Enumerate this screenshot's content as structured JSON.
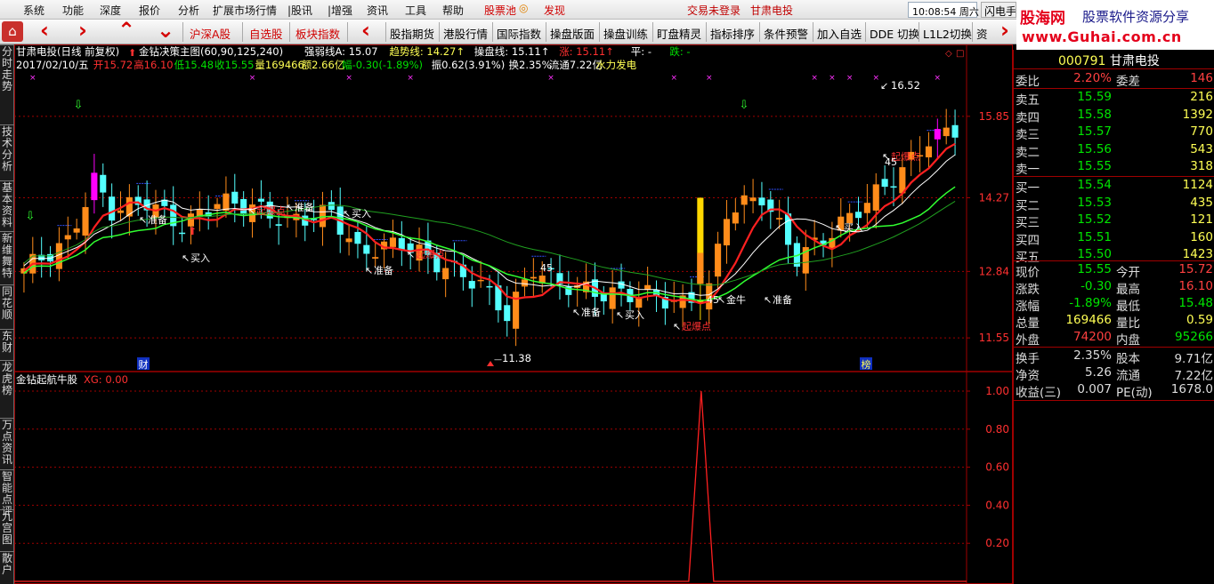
{
  "menu": [
    "系统",
    "功能",
    "深度",
    "报价",
    "分析",
    "扩展市场行情",
    "|股讯",
    "|增强",
    "资讯",
    "工具",
    "帮助"
  ],
  "menu_red": [
    "股票池",
    "发现"
  ],
  "login_text": "交易未登录",
  "broker_text": "甘肃电投",
  "clock": "10:08:54 周六",
  "flash": "闪电手",
  "logo": {
    "brand": "股海网",
    "slogan": "股票软件资源分享",
    "url": "www.Guhai.com.cn"
  },
  "toolbar": {
    "red": [
      "沪深A股",
      "自选股",
      "板块指数"
    ],
    "black": [
      "股指期货",
      "港股行情",
      "国际指数",
      "操盘版面",
      "操盘训练",
      "盯盘精灵",
      "指标排序",
      "条件预警",
      "加入自选",
      "DDE 切换",
      "L1L2切换",
      "资"
    ]
  },
  "left_tabs": [
    "分时走势",
    "技术分析",
    "基本资料",
    "新维舞特",
    "同花顺",
    "东财",
    "龙虎榜",
    "万点资讯",
    "智能点评",
    "九宫图",
    "散户"
  ],
  "header": {
    "line1_name": "甘肃电投(日线 前复权)",
    "line1_indicator": "金钻决策主图(60,90,125,240)",
    "line1_parts": [
      {
        "t": "强弱线A: 15.07",
        "c": "#ffffff"
      },
      {
        "t": "趋势线: 14.27↑",
        "c": "#ffff54"
      },
      {
        "t": "操盘线: 15.11↑",
        "c": "#ffffff"
      },
      {
        "t": "涨: 15.11↑",
        "c": "#ff3030"
      },
      {
        "t": "平: -",
        "c": "#ffffff"
      },
      {
        "t": "跌: -",
        "c": "#00e000"
      }
    ],
    "line2_parts": [
      {
        "t": "2017/02/10/五",
        "c": "#ffffff"
      },
      {
        "t": "开15.72",
        "c": "#ff3030"
      },
      {
        "t": "高16.10",
        "c": "#ff3030"
      },
      {
        "t": "低15.48",
        "c": "#00e000"
      },
      {
        "t": "收15.55",
        "c": "#00e000"
      },
      {
        "t": "量169466",
        "c": "#ffff54"
      },
      {
        "t": "额2.66亿",
        "c": "#ffff54"
      },
      {
        "t": "幅-0.30(-1.89%)",
        "c": "#00e000"
      },
      {
        "t": "振0.62(3.91%)",
        "c": "#ffffff"
      },
      {
        "t": "换2.35%",
        "c": "#ffffff"
      },
      {
        "t": "流通7.22亿",
        "c": "#ffffff"
      },
      {
        "t": "水力发电",
        "c": "#ffff54"
      }
    ]
  },
  "main_axis": {
    "ticks": [
      "15.85",
      "14.27",
      "12.84",
      "11.55"
    ]
  },
  "sub": {
    "title": "金钻起航牛股",
    "value_label": "XG: 0.00",
    "ticks": [
      "1.00",
      "0.80",
      "0.60",
      "0.40",
      "0.20"
    ]
  },
  "marks": {
    "high": "16.52",
    "low": "11.38",
    "mid1": "45",
    "mid2": "45",
    "mid3": "45"
  },
  "signals": {
    "zhunbei": "准备",
    "mairu": "买入",
    "qibaodian": "起爆点",
    "jinniu": "金牛",
    "cai": "财",
    "bang": "榜"
  },
  "colors": {
    "up": "#ff8c1a",
    "down": "#54ffff",
    "red_line": "#ff2020",
    "green_line": "#20d020",
    "white_line": "#ffffff",
    "magenta": "#ff00ff",
    "grid": "#a00000"
  },
  "chart_data": {
    "type": "candlestick",
    "count": 107,
    "ylim": [
      11.0,
      16.9
    ],
    "close_last": 15.55,
    "bigbar_index": 77,
    "signal_value": 1.0
  },
  "quote": {
    "code": "000791",
    "name": "甘肃电投",
    "weibi": {
      "label": "委比",
      "value": "2.20%",
      "label2": "委差",
      "value2": "146"
    },
    "asks": [
      {
        "l": "卖五",
        "p": "15.59",
        "v": "216"
      },
      {
        "l": "卖四",
        "p": "15.58",
        "v": "1392"
      },
      {
        "l": "卖三",
        "p": "15.57",
        "v": "770"
      },
      {
        "l": "卖二",
        "p": "15.56",
        "v": "543"
      },
      {
        "l": "卖一",
        "p": "15.55",
        "v": "318"
      }
    ],
    "bids": [
      {
        "l": "买一",
        "p": "15.54",
        "v": "1124"
      },
      {
        "l": "买二",
        "p": "15.53",
        "v": "435"
      },
      {
        "l": "买三",
        "p": "15.52",
        "v": "121"
      },
      {
        "l": "买四",
        "p": "15.51",
        "v": "160"
      },
      {
        "l": "买五",
        "p": "15.50",
        "v": "1423"
      }
    ],
    "stats": [
      {
        "a": "现价",
        "b": "15.55",
        "bc": "g",
        "c": "今开",
        "d": "15.72",
        "dc": "r"
      },
      {
        "a": "涨跌",
        "b": "-0.30",
        "bc": "g",
        "c": "最高",
        "d": "16.10",
        "dc": "r"
      },
      {
        "a": "涨幅",
        "b": "-1.89%",
        "bc": "g",
        "c": "最低",
        "d": "15.48",
        "dc": "g"
      },
      {
        "a": "总量",
        "b": "169466",
        "bc": "y",
        "c": "量比",
        "d": "0.59",
        "dc": "y"
      },
      {
        "a": "外盘",
        "b": "74200",
        "bc": "r",
        "c": "内盘",
        "d": "95266",
        "dc": "g"
      }
    ],
    "stats2": [
      {
        "a": "换手",
        "b": "2.35%",
        "bc": "w",
        "c": "股本",
        "d": "9.71亿",
        "dc": "w"
      },
      {
        "a": "净资",
        "b": "5.26",
        "bc": "w",
        "c": "流通",
        "d": "7.22亿",
        "dc": "w"
      },
      {
        "a": "收益(三)",
        "b": "0.007",
        "bc": "w",
        "c": "PE(动)",
        "d": "1678.0",
        "dc": "w"
      }
    ]
  }
}
